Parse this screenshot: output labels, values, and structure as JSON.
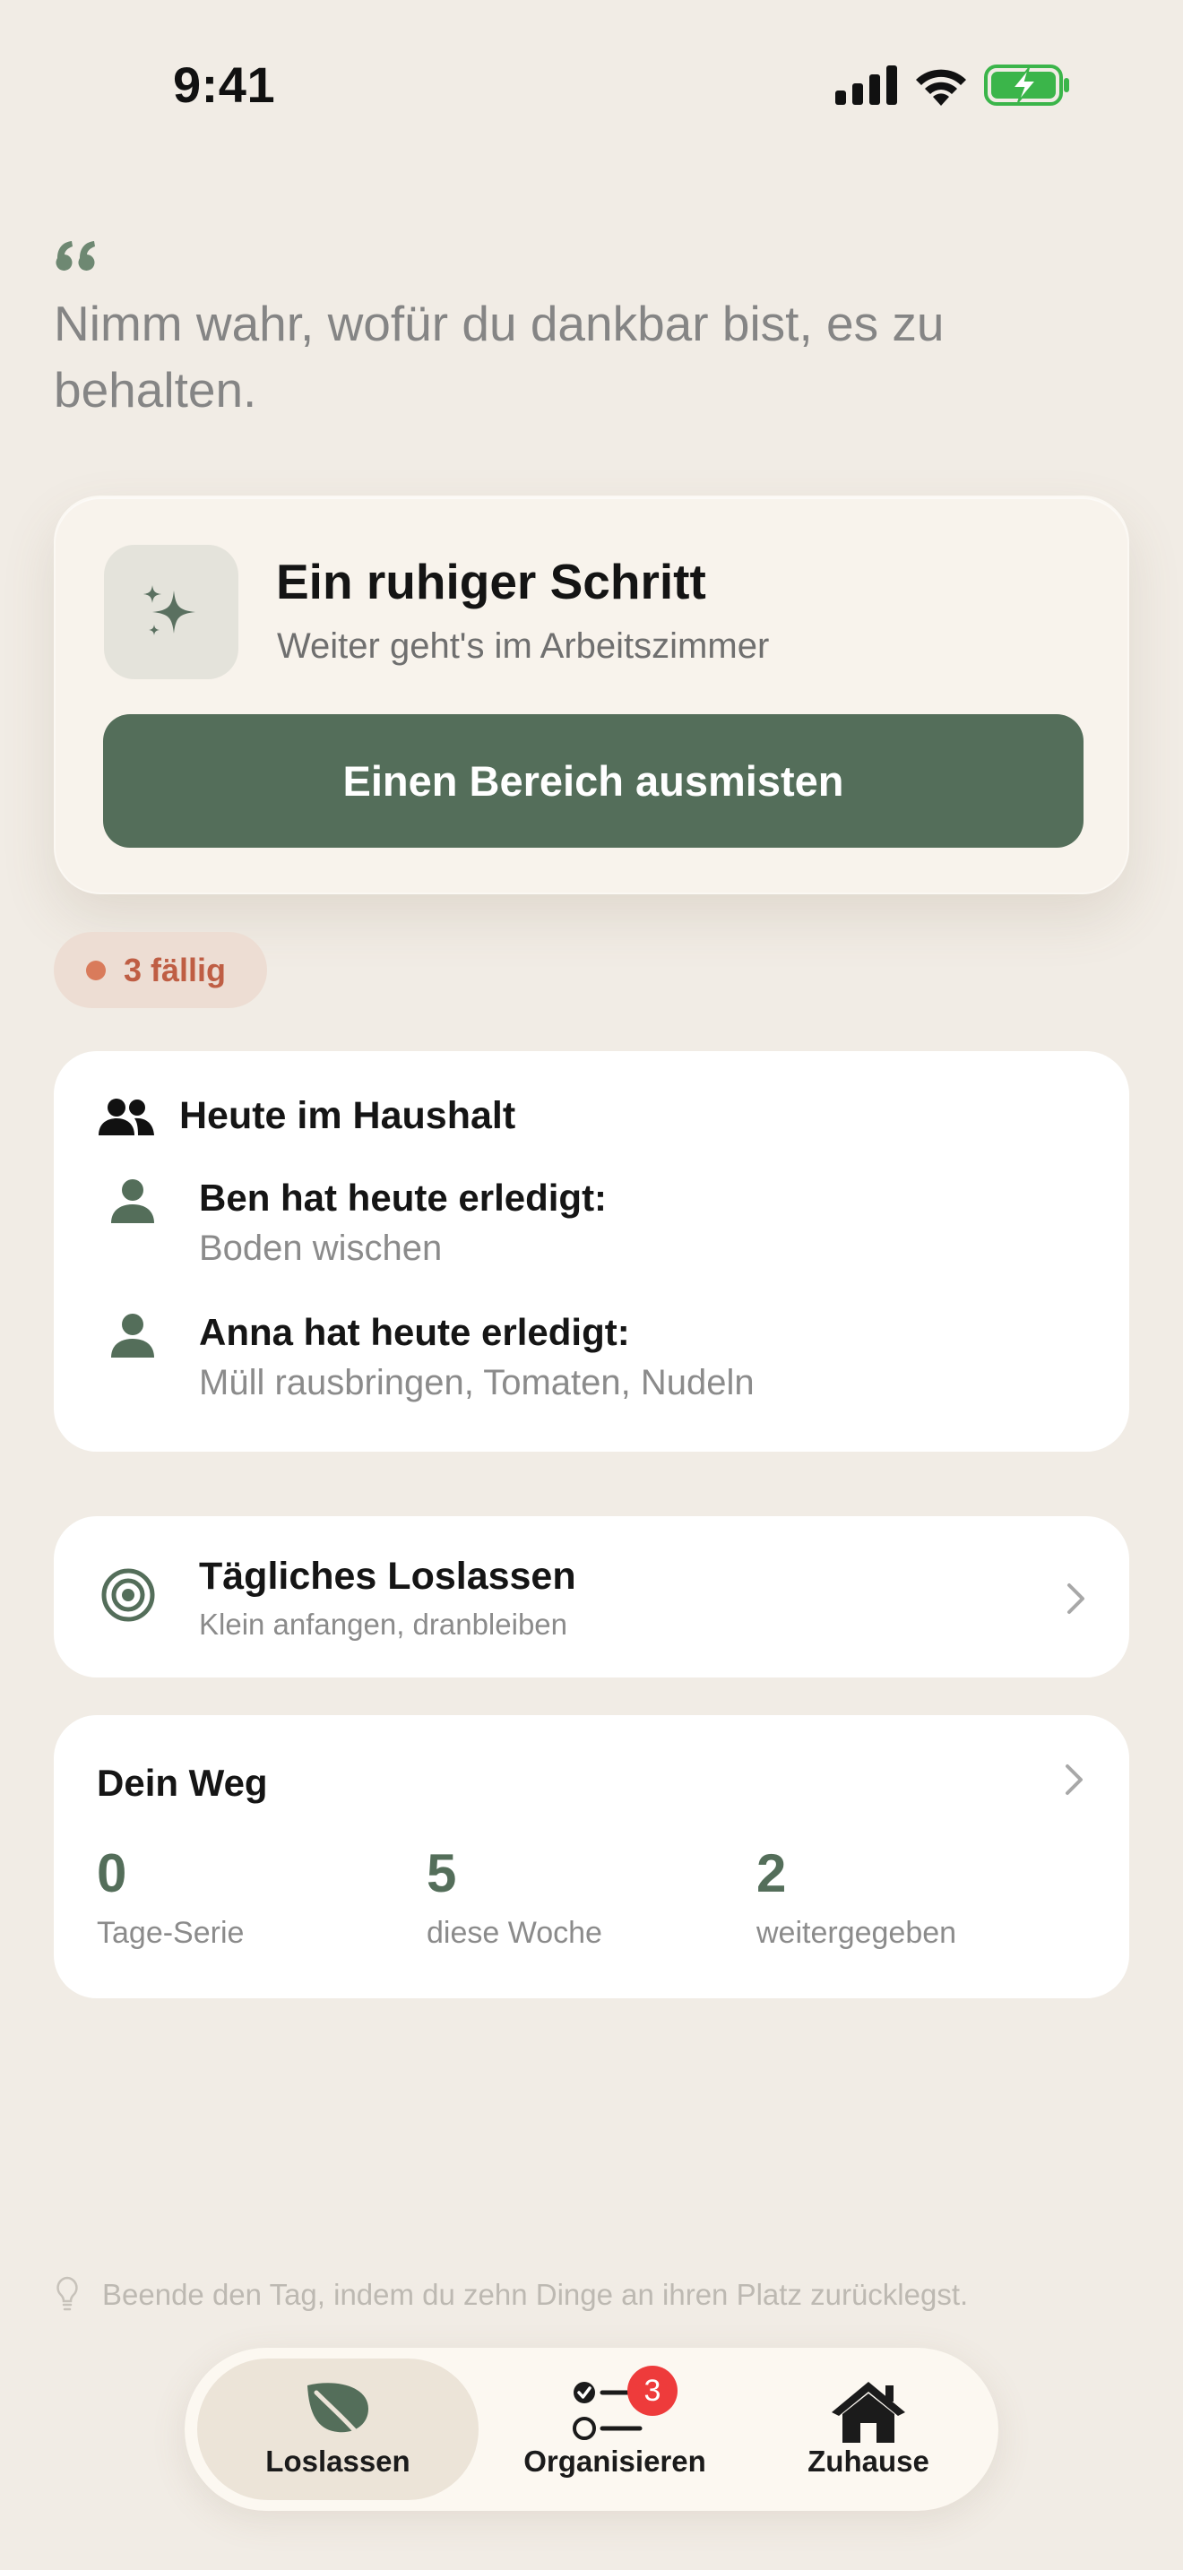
{
  "status_bar": {
    "time": "9:41"
  },
  "quote": {
    "text": "Nimm wahr, wofür du dankbar bist, es zu behalten."
  },
  "hero": {
    "title": "Ein ruhiger Schritt",
    "subtitle": "Weiter geht's im Arbeitszimmer",
    "button_label": "Einen Bereich ausmisten",
    "icon": "sparkles-icon"
  },
  "due_badge": {
    "label": "3 fällig"
  },
  "household": {
    "title": "Heute im Haushalt",
    "entries": [
      {
        "title": "Ben hat heute erledigt:",
        "tasks": "Boden wischen"
      },
      {
        "title": "Anna hat heute erledigt:",
        "tasks": "Müll rausbringen, Tomaten, Nudeln"
      }
    ]
  },
  "daily": {
    "title": "Tägliches Loslassen",
    "subtitle": "Klein anfangen, dranbleiben"
  },
  "path": {
    "title": "Dein Weg",
    "stats": [
      {
        "value": "0",
        "label": "Tage-Serie"
      },
      {
        "value": "5",
        "label": "diese Woche"
      },
      {
        "value": "2",
        "label": "weitergegeben"
      }
    ]
  },
  "tip": {
    "text": "Beende den Tag, indem du zehn Dinge an ihren Platz zurücklegst."
  },
  "tabbar": {
    "tabs": [
      {
        "label": "Loslassen",
        "icon": "leaf-icon",
        "active": true
      },
      {
        "label": "Organisieren",
        "icon": "checklist-icon",
        "badge": "3"
      },
      {
        "label": "Zuhause",
        "icon": "house-icon"
      }
    ]
  },
  "colors": {
    "background": "#F1ECE5",
    "accent_green": "#546E5A",
    "due_badge_bg": "#EDDDD3",
    "due_text": "#BF5E44",
    "badge_red": "#EE3B3B"
  }
}
